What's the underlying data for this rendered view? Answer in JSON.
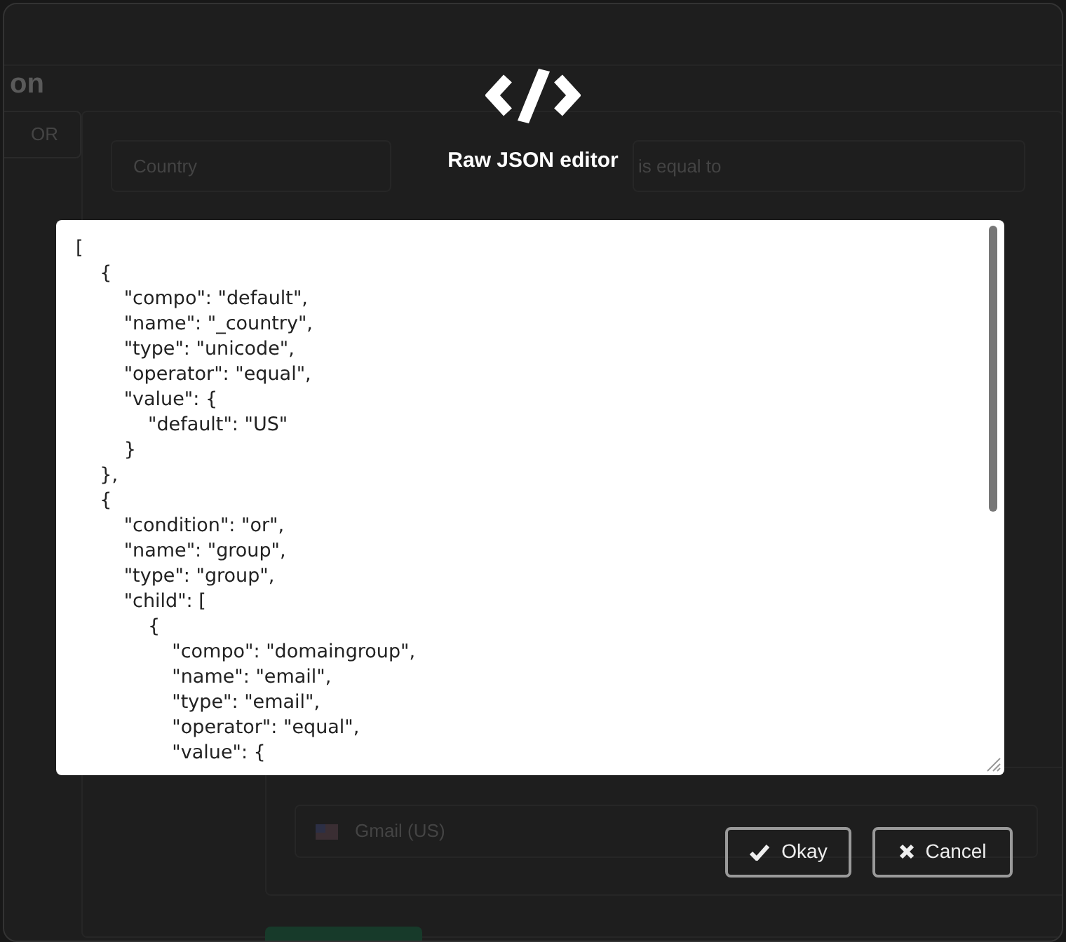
{
  "backdrop": {
    "heading": "on",
    "or_button": "OR",
    "field": "Country",
    "operator": "is equal to",
    "option": "Gmail (US)"
  },
  "modal": {
    "title": "Raw JSON editor",
    "editor": {
      "text": "[\n    {\n        \"compo\": \"default\",\n        \"name\": \"_country\",\n        \"type\": \"unicode\",\n        \"operator\": \"equal\",\n        \"value\": {\n            \"default\": \"US\"\n        }\n    },\n    {\n        \"condition\": \"or\",\n        \"name\": \"group\",\n        \"type\": \"group\",\n        \"child\": [\n            {\n                \"compo\": \"domaingroup\",\n                \"name\": \"email\",\n                \"type\": \"email\",\n                \"operator\": \"equal\",\n                \"value\": {"
    },
    "buttons": [
      {
        "label": "Okay",
        "kind": "ok"
      },
      {
        "label": "Cancel",
        "kind": "cancel"
      }
    ]
  }
}
